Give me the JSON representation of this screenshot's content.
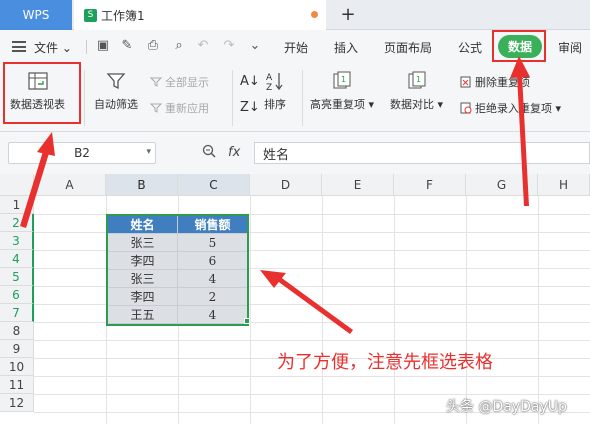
{
  "titlebar": {
    "app_tab": "WPS",
    "doc_tab": "工作簿1",
    "new_tab_symbol": "+"
  },
  "menu": {
    "file": "文件",
    "tabs": [
      "开始",
      "插入",
      "页面布局",
      "公式",
      "数据",
      "审阅"
    ],
    "active_tab": "数据"
  },
  "ribbon": {
    "pivot": "数据透视表",
    "autofilter": "自动筛选",
    "show_all": "全部显示",
    "reapply": "重新应用",
    "sort": "排序",
    "highlight_dup": "高亮重复项",
    "compare": "数据对比",
    "delete_dup": "删除重复项",
    "reject_dup": "拒绝录入重复项"
  },
  "formula_bar": {
    "cell_ref": "B2",
    "fx": "fx",
    "content": "姓名"
  },
  "grid": {
    "columns": [
      "A",
      "B",
      "C",
      "D",
      "E",
      "F",
      "G",
      "H"
    ],
    "rows": [
      "1",
      "2",
      "3",
      "4",
      "5",
      "6",
      "7",
      "8",
      "9",
      "10",
      "11",
      "12"
    ]
  },
  "table": {
    "headers": [
      "姓名",
      "销售额"
    ],
    "rows": [
      [
        "张三",
        "5"
      ],
      [
        "李四",
        "6"
      ],
      [
        "张三",
        "4"
      ],
      [
        "李四",
        "2"
      ],
      [
        "王五",
        "4"
      ]
    ]
  },
  "annotation": {
    "text": "为了方便，注意先框选表格",
    "color": "#e8312f"
  },
  "watermark": "头条 @DayDayUp"
}
